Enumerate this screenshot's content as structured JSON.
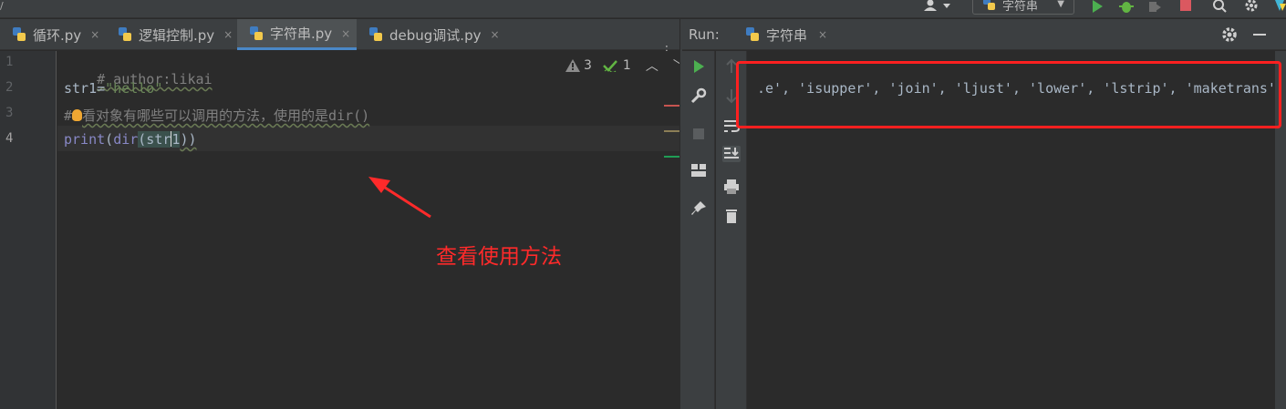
{
  "toolbar": {
    "run_config_label": "字符串",
    "edge_glyph": "/"
  },
  "editor": {
    "tabs": [
      {
        "label": "循环.py",
        "active": false
      },
      {
        "label": "逻辑控制.py",
        "active": false
      },
      {
        "label": "字符串.py",
        "active": true
      },
      {
        "label": "debug调试.py",
        "active": false
      }
    ],
    "close_glyph": "×",
    "line_numbers": [
      "1",
      "2",
      "3",
      "4"
    ],
    "current_line": 4,
    "lines": {
      "l1_comment": "# author:likai",
      "l2_var": "str1",
      "l2_eq": "=",
      "l2_str": "\"hello\"",
      "l3_hash": "#",
      "l3_text": "看对象有哪些可以调用的方法，使用的是dir()",
      "l4_print": "print",
      "l4_open": "(",
      "l4_dir": "dir",
      "l4_arg_a": "(str",
      "l4_arg_b": "1",
      "l4_close": "))"
    },
    "inspections": {
      "warnings": "3",
      "typos": "1"
    },
    "marker_colors": [
      "#c75450",
      "#8c7e56",
      "#1f9d55"
    ]
  },
  "annotation": {
    "text": "查看使用方法",
    "color": "#ff2a2a"
  },
  "run_panel": {
    "label": "Run:",
    "tab_label": "字符串",
    "console_output": ".e', 'isupper', 'join', 'ljust', 'lower', 'lstrip', 'maketrans'"
  },
  "colors": {
    "accent": "#4a88c7",
    "highlight_box": "#ff2020",
    "run_green": "#4caf50",
    "debug_green": "#62b543",
    "stop_red": "#db5860"
  }
}
